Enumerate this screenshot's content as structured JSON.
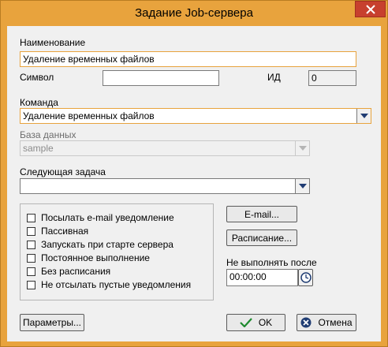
{
  "window": {
    "title": "Задание Job-сервера",
    "close_icon": "close-icon",
    "accent_color": "#e8a33d"
  },
  "form": {
    "name_label": "Наименование",
    "name_value": "Удаление временных файлов",
    "symbol_label": "Символ",
    "symbol_value": "",
    "id_label": "ИД",
    "id_value": "0",
    "command_label": "Команда",
    "command_value": "Удаление временных файлов",
    "database_label": "База данных",
    "database_value": "sample",
    "next_task_label": "Следующая задача",
    "next_task_value": ""
  },
  "options": [
    {
      "label": "Посылать e-mail уведомление",
      "checked": false
    },
    {
      "label": "Пассивная",
      "checked": false
    },
    {
      "label": "Запускать при старте сервера",
      "checked": false
    },
    {
      "label": "Постоянное выполнение",
      "checked": false
    },
    {
      "label": "Без расписания",
      "checked": false
    },
    {
      "label": "Не отсылать пустые уведомления",
      "checked": false
    }
  ],
  "buttons": {
    "email": "E-mail...",
    "schedule": "Расписание...",
    "params": "Параметры...",
    "ok": "OK",
    "cancel": "Отмена"
  },
  "not_after": {
    "label": "Не выполнять после",
    "value": "00:00:00",
    "icon": "clock-icon"
  }
}
